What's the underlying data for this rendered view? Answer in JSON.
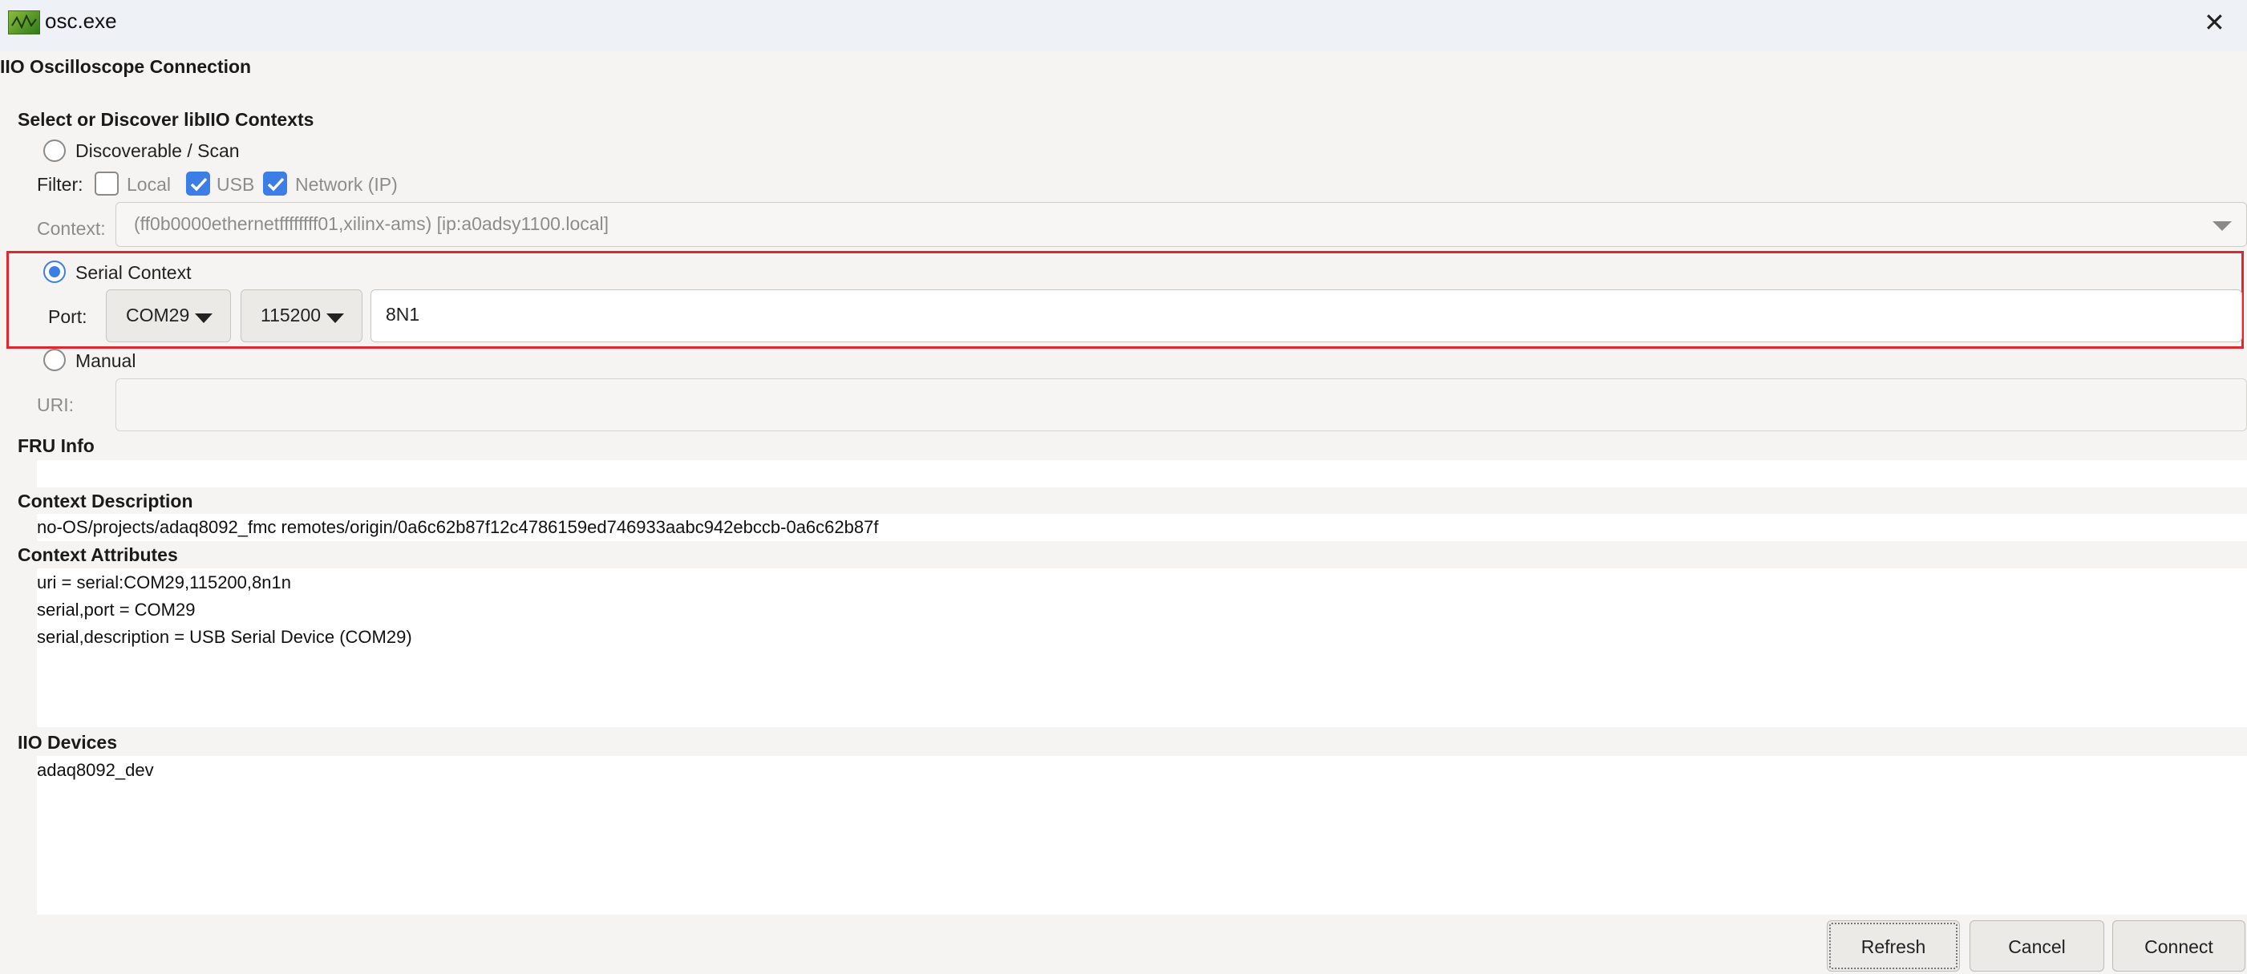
{
  "window": {
    "title": "osc.exe"
  },
  "dialog_title": "IIO Oscilloscope Connection",
  "contexts": {
    "heading": "Select or Discover libIIO Contexts",
    "discover_label": "Discoverable / Scan",
    "filter_label": "Filter:",
    "filter_local": "Local",
    "filter_usb": "USB",
    "filter_network": "Network (IP)",
    "context_label": "Context:",
    "context_value": "(ff0b0000ethernetffffffff01,xilinx-ams) [ip:a0adsy1100.local]",
    "serial_label": "Serial Context",
    "port_label": "Port:",
    "port_value": "COM29",
    "baud_value": "115200",
    "serial_config": "8N1",
    "manual_label": "Manual",
    "uri_label": "URI:",
    "uri_value": ""
  },
  "fru": {
    "heading": "FRU Info"
  },
  "description": {
    "heading": "Context Description",
    "text": "no-OS/projects/adaq8092_fmc remotes/origin/0a6c62b87f12c4786159ed746933aabc942ebccb-0a6c62b87f"
  },
  "attributes": {
    "heading": "Context Attributes",
    "lines": [
      "uri = serial:COM29,115200,8n1n",
      "serial,port = COM29",
      "serial,description = USB Serial Device (COM29)"
    ]
  },
  "devices": {
    "heading": "IIO Devices",
    "lines": [
      "adaq8092_dev"
    ]
  },
  "buttons": {
    "refresh": "Refresh",
    "cancel": "Cancel",
    "connect": "Connect"
  },
  "colors": {
    "accent": "#3d7ee6",
    "highlight_border": "#e0262f"
  }
}
